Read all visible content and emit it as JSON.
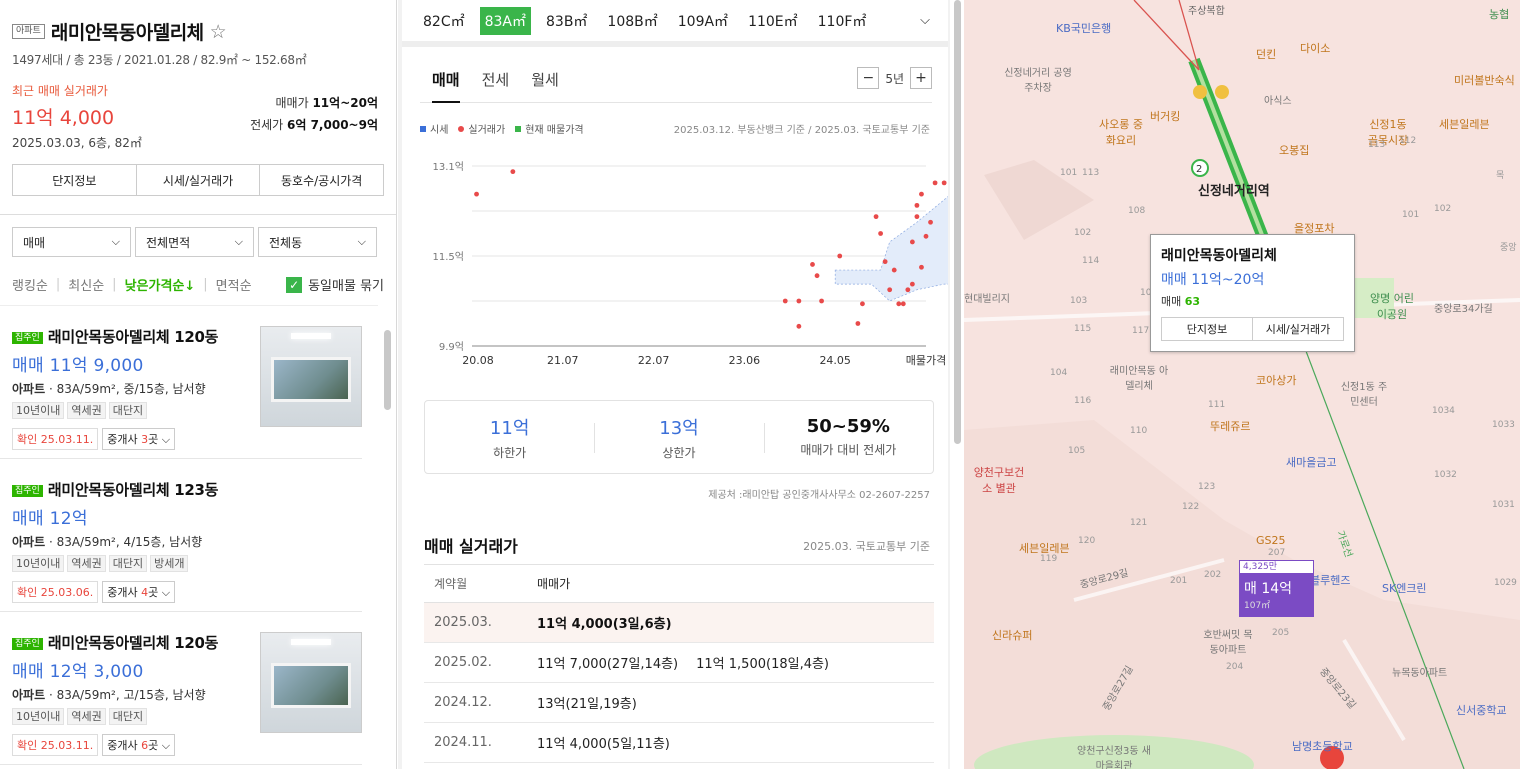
{
  "complex": {
    "type_chip": "아파트",
    "name": "래미안목동아델리체",
    "star": "☆",
    "meta": "1497세대 / 총 23동 / 2021.01.28 / 82.9㎡ ~ 152.68㎡",
    "recent_label": "최근 매매 실거래가",
    "recent_price": "11억 4,000",
    "recent_date": "2025.03.03, 6층, 82㎡",
    "sale_range_label": "매매가",
    "sale_range": "11억~20억",
    "jeonse_range_label": "전세가",
    "jeonse_range": "6억 7,000~9억"
  },
  "info_tabs": [
    "단지정보",
    "시세/실거래가",
    "동호수/공시가격"
  ],
  "filters": [
    "매매",
    "전체면적",
    "전체동"
  ],
  "sorts": [
    "랭킹순",
    "최신순",
    "낮은가격순↓",
    "면적순"
  ],
  "group_checkbox_label": "동일매물 묶기",
  "listings": [
    {
      "owner": "집주인",
      "name": "래미안목동아델리체 120동",
      "price": "매매 11억 9,000",
      "desc_bold": "아파트",
      "desc": " · 83A/59m², 중/15층, 남서향",
      "tags": [
        "10년이내",
        "역세권",
        "대단지"
      ],
      "confirm": "확인 25.03.11.",
      "broker_pre": "중개사 ",
      "broker_num": "3",
      "broker_post": "곳 ⌵"
    },
    {
      "owner": "집주인",
      "name": "래미안목동아델리체 123동",
      "price": "매매 12억",
      "desc_bold": "아파트",
      "desc": " · 83A/59m², 4/15층, 남서향",
      "tags": [
        "10년이내",
        "역세권",
        "대단지",
        "방세개"
      ],
      "confirm": "확인 25.03.06.",
      "broker_pre": "중개사 ",
      "broker_num": "4",
      "broker_post": "곳 ⌵"
    },
    {
      "owner": "집주인",
      "name": "래미안목동아델리체 120동",
      "price": "매매 12억 3,000",
      "desc_bold": "아파트",
      "desc": " · 83A/59m², 고/15층, 남서향",
      "tags": [
        "10년이내",
        "역세권",
        "대단지"
      ],
      "confirm": "확인 25.03.11.",
      "broker_pre": "중개사 ",
      "broker_num": "6",
      "broker_post": "곳 ⌵"
    }
  ],
  "area_tabs": [
    "82C㎡",
    "83A㎡",
    "83B㎡",
    "108B㎡",
    "109A㎡",
    "110E㎡",
    "110F㎡"
  ],
  "area_tab_active": "83A㎡",
  "deal_tabs": [
    "매매",
    "전세",
    "월세"
  ],
  "period": "5년",
  "legend": {
    "items": [
      "시세",
      "실거래가",
      "현재 매물가격"
    ],
    "source": "2025.03.12. 부동산뱅크 기준 / 2025.03. 국토교통부 기준"
  },
  "chart_data": {
    "type": "scatter",
    "x_ticks": [
      "20.08",
      "21.07",
      "22.07",
      "23.06",
      "24.05",
      "매물가격"
    ],
    "y_ticks": [
      "13.1억",
      "11.5억",
      "9.9억"
    ],
    "ylim": [
      9.9,
      13.1
    ],
    "series": [
      {
        "name": "실거래가",
        "color": "#e84a4a",
        "points": [
          [
            0.05,
            12.6
          ],
          [
            0.45,
            13.0
          ],
          [
            3.45,
            10.7
          ],
          [
            3.6,
            10.25
          ],
          [
            3.6,
            10.7
          ],
          [
            3.75,
            11.35
          ],
          [
            3.8,
            11.15
          ],
          [
            3.85,
            10.7
          ],
          [
            4.05,
            11.5
          ],
          [
            4.25,
            10.3
          ],
          [
            4.3,
            10.65
          ],
          [
            4.45,
            12.2
          ],
          [
            4.5,
            11.9
          ],
          [
            4.55,
            11.4
          ],
          [
            4.6,
            10.9
          ],
          [
            4.65,
            11.25
          ],
          [
            4.7,
            10.65
          ],
          [
            4.75,
            10.65
          ],
          [
            4.8,
            10.9
          ],
          [
            4.85,
            11.0
          ],
          [
            4.85,
            11.75
          ],
          [
            4.9,
            12.2
          ],
          [
            4.9,
            12.4
          ],
          [
            4.95,
            12.6
          ],
          [
            4.95,
            11.3
          ],
          [
            5.0,
            11.85
          ],
          [
            5.05,
            12.1
          ],
          [
            5.1,
            12.8
          ],
          [
            5.2,
            12.8
          ],
          [
            5.35,
            11.4
          ],
          [
            5.45,
            11.4
          ],
          [
            5.55,
            12.95
          ],
          [
            5.8,
            11.2
          ],
          [
            5.85,
            11.7
          ],
          [
            5.95,
            11.4
          ]
        ]
      },
      {
        "name": "현재 매물가격",
        "color": "#3ab54a",
        "range": [
          11.0,
          13.0
        ]
      }
    ]
  },
  "stats": [
    {
      "value": "11억",
      "label": "하한가"
    },
    {
      "value": "13억",
      "label": "상한가"
    },
    {
      "value": "50~59%",
      "label": "매매가 대비 전세가"
    }
  ],
  "provider": "제공처 :래미안탑 공인중개사사무소 02-2607-2257",
  "tx": {
    "title": "매매 실거래가",
    "basis": "2025.03. 국토교통부 기준",
    "headers": [
      "계약월",
      "매매가"
    ],
    "rows": [
      {
        "month": "2025.03.",
        "deals": [
          "11억 4,000(3일,6층)"
        ]
      },
      {
        "month": "2025.02.",
        "deals": [
          "11억 7,000(27일,14층)",
          "11억 1,500(18일,4층)"
        ]
      },
      {
        "month": "2024.12.",
        "deals": [
          "13억(21일,19층)"
        ]
      },
      {
        "month": "2024.11.",
        "deals": [
          "11억 4,000(5일,11층)"
        ]
      }
    ]
  },
  "map": {
    "popup": {
      "title": "래미안목동아델리체",
      "price": "매매 11억~20억",
      "count_label": "매매 ",
      "count": "63",
      "buttons": [
        "단지정보",
        "시세/실거래가"
      ]
    },
    "marker": {
      "top": "4,325만",
      "price": "매 14억",
      "size": "107㎡"
    },
    "labels": [
      "주상복합",
      "농협",
      "KB국민은행",
      "다이소",
      "던킨",
      "신정네거리 공영주차장",
      "버거킹",
      "아식스",
      "미러볼반숙식",
      "사오롱 중화요리",
      "오봉집",
      "신정1동 골목시장",
      "세븐일레븐",
      "신정네거리역",
      "을정포차",
      "현대빌리지",
      "양명 어린이공원",
      "중앙로34가길",
      "래미안목동 아델리체",
      "코아상가",
      "신정1동 주민센터",
      "뚜레쥬르",
      "양천구보건소 별관",
      "새마을금고",
      "세븐일레븐",
      "GS25",
      "블루헨즈",
      "SK엔크린",
      "중앙로29길",
      "신라슈퍼",
      "호반써밋 목동아파트",
      "뉴목동아파트",
      "신서중학교",
      "양천구신정3동 새마을회관",
      "남명초등학교",
      "중앙로27길",
      "중앙로23길",
      "가로선"
    ]
  }
}
